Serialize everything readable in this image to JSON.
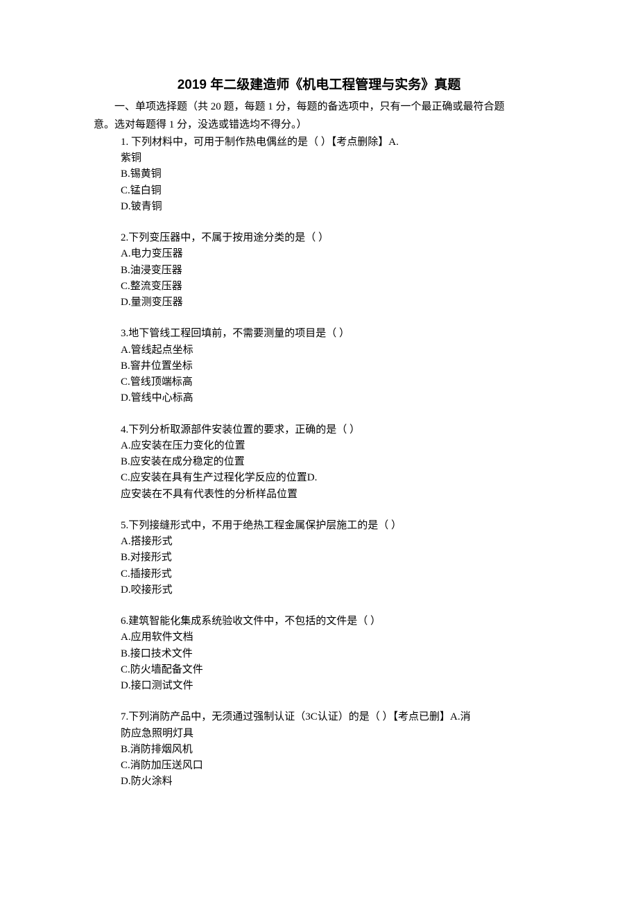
{
  "title": "2019 年二级建造师《机电工程管理与实务》真题",
  "instructions_line1": "一、单项选择题（共 20 题，每题 1 分，每题的备选项中，只有一个最正确或最符合题",
  "instructions_line2": "意。选对每题得 1 分，没选或错选均不得分。）",
  "questions": [
    {
      "lines": [
        "1. 下列材料中，可用于制作热电偶丝的是（ ）【考点删除】A.",
        "紫铜",
        "B.锡黄铜",
        "C.锰白铜",
        "D.铍青铜"
      ]
    },
    {
      "lines": [
        "2.下列变压器中，不属于按用途分类的是（ ）",
        "A.电力变压器",
        "B.油浸变压器",
        "C.整流变压器",
        "D.量测变压器"
      ]
    },
    {
      "lines": [
        "3.地下管线工程回填前，不需要测量的项目是（ ）",
        "A.管线起点坐标",
        "B.窨井位置坐标",
        "C.管线顶端标高",
        "D.管线中心标高"
      ]
    },
    {
      "lines": [
        "4.下列分析取源部件安装位置的要求，正确的是（ ）",
        "A.应安装在压力变化的位置",
        "B.应安装在成分稳定的位置",
        "C.应安装在具有生产过程化学反应的位置D.",
        "应安装在不具有代表性的分析样品位置"
      ]
    },
    {
      "lines": [
        "5.下列接缝形式中，不用于绝热工程金属保护层施工的是（ ）",
        "A.搭接形式",
        "B.对接形式",
        "C.插接形式",
        "D.咬接形式"
      ]
    },
    {
      "lines": [
        "6.建筑智能化集成系统验收文件中，不包括的文件是（ ）",
        "A.应用软件文档",
        "B.接口技术文件",
        "C.防火墙配备文件",
        "D.接口测试文件"
      ]
    },
    {
      "lines": [
        "7.下列消防产品中，无须通过强制认证（3C认证）的是（ ）【考点已删】A.消",
        "防应急照明灯具",
        "B.消防排烟风机",
        "C.消防加压送风口",
        "D.防火涂料"
      ]
    }
  ]
}
